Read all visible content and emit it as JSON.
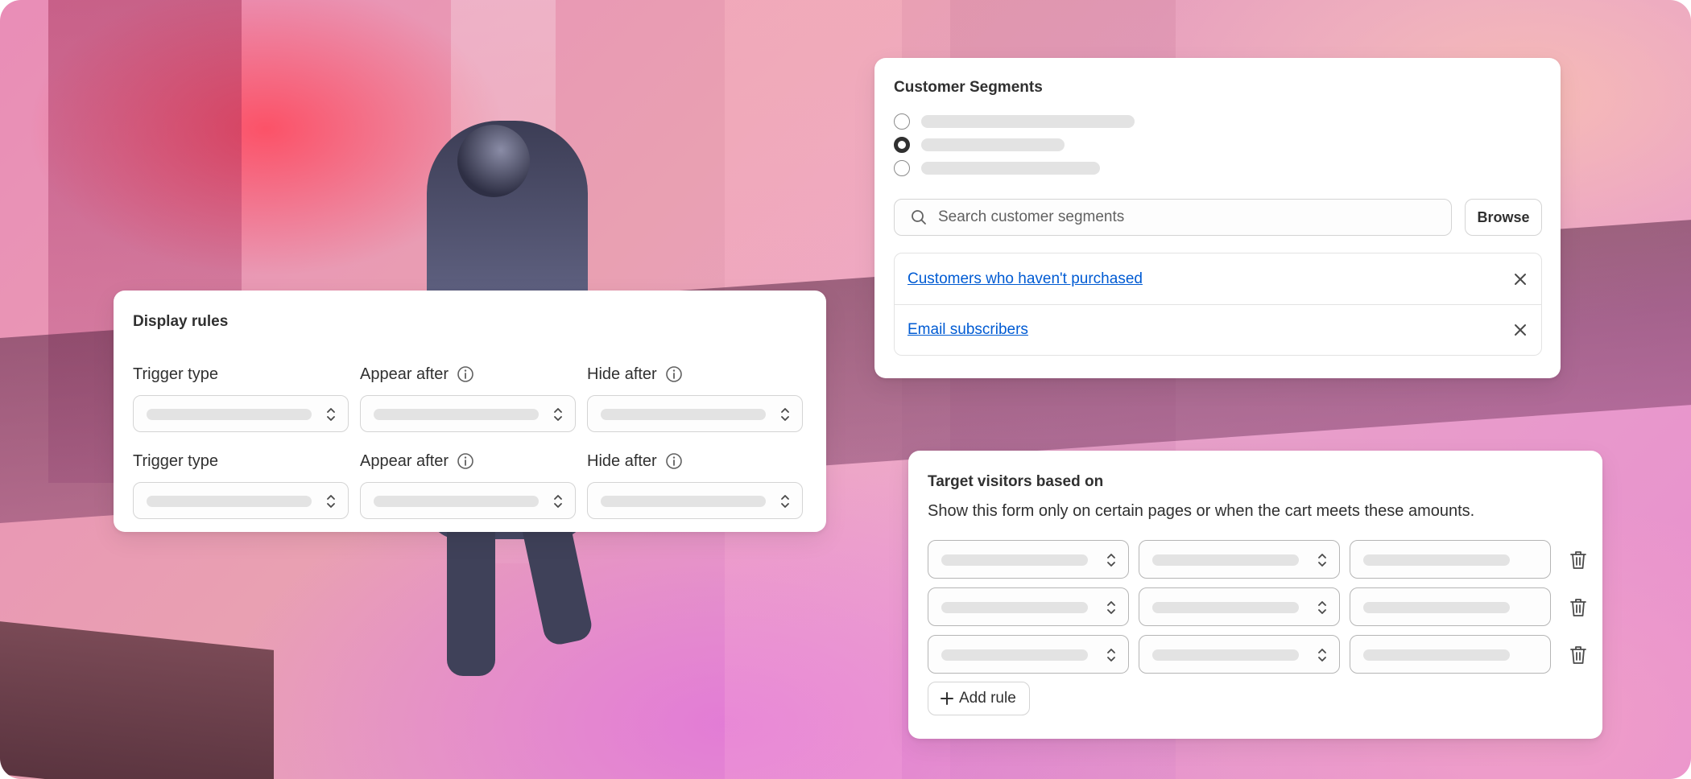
{
  "display_rules": {
    "title": "Display rules",
    "rows": [
      {
        "trigger_label": "Trigger type",
        "appear_label": "Appear after",
        "hide_label": "Hide after"
      },
      {
        "trigger_label": "Trigger type",
        "appear_label": "Appear after",
        "hide_label": "Hide after"
      }
    ]
  },
  "segments": {
    "title": "Customer Segments",
    "radio_selected_index": 1,
    "search_placeholder": "Search customer segments",
    "browse_label": "Browse",
    "selected": [
      {
        "label": "Customers who haven't purchased"
      },
      {
        "label": "Email subscribers"
      }
    ]
  },
  "target": {
    "title": "Target visitors based on",
    "description": "Show this form only on certain pages or when the cart meets these amounts.",
    "add_rule_label": "Add rule"
  },
  "icons": {
    "info": "info-icon",
    "select": "chevron-up-down-icon",
    "search": "search-icon",
    "close": "close-icon",
    "delete": "trash-icon",
    "add": "plus-icon"
  },
  "colors": {
    "link": "#005bd3",
    "text": "#303030",
    "placeholder_bar": "#e3e3e3"
  }
}
